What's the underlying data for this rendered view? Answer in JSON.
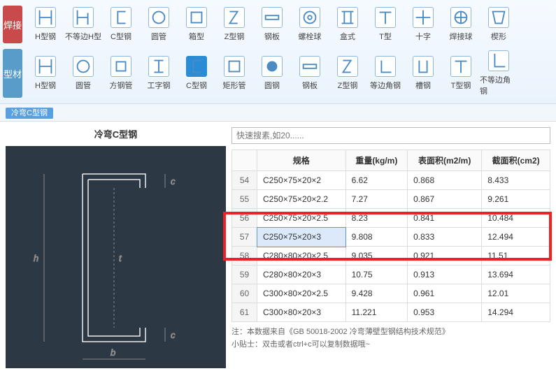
{
  "ribbon": {
    "row1": {
      "tab": "焊接",
      "items": [
        {
          "label": "H型钢",
          "icon": "H"
        },
        {
          "label": "不等边H型",
          "icon": "H2"
        },
        {
          "label": "C型钢",
          "icon": "C"
        },
        {
          "label": "圆管",
          "icon": "circle"
        },
        {
          "label": "箱型",
          "icon": "rect"
        },
        {
          "label": "Z型钢",
          "icon": "Z"
        },
        {
          "label": "钢板",
          "icon": "plate"
        },
        {
          "label": "螺栓球",
          "icon": "bolt"
        },
        {
          "label": "盒式",
          "icon": "box"
        },
        {
          "label": "T型",
          "icon": "T"
        },
        {
          "label": "十字",
          "icon": "cross"
        },
        {
          "label": "焊接球",
          "icon": "ball"
        },
        {
          "label": "楔形",
          "icon": "wedge"
        }
      ]
    },
    "row2": {
      "tab": "型材",
      "items": [
        {
          "label": "H型钢",
          "icon": "H"
        },
        {
          "label": "圆管",
          "icon": "circle"
        },
        {
          "label": "方钢管",
          "icon": "sq"
        },
        {
          "label": "工字钢",
          "icon": "I"
        },
        {
          "label": "C型钢",
          "icon": "C",
          "active": true
        },
        {
          "label": "矩形管",
          "icon": "rect"
        },
        {
          "label": "圆钢",
          "icon": "solid"
        },
        {
          "label": "钢板",
          "icon": "plate"
        },
        {
          "label": "Z型钢",
          "icon": "Z"
        },
        {
          "label": "等边角钢",
          "icon": "L"
        },
        {
          "label": "槽钢",
          "icon": "U"
        },
        {
          "label": "T型钢",
          "icon": "T"
        },
        {
          "label": "不等边角钢",
          "icon": "L2"
        }
      ]
    }
  },
  "breadcrumb": "冷弯C型钢",
  "left": {
    "title": "冷弯C型钢"
  },
  "search": {
    "placeholder": "快速搜素,如20......"
  },
  "table": {
    "headers": {
      "spec": "规格",
      "weight": "重量(kg/m)",
      "area": "表面积(m2/m)",
      "section": "截面积(cm2)"
    },
    "rows": [
      {
        "n": 54,
        "spec": "C250×75×20×2",
        "w": "6.62",
        "a": "0.868",
        "s": "8.433"
      },
      {
        "n": 55,
        "spec": "C250×75×20×2.2",
        "w": "7.27",
        "a": "0.867",
        "s": "9.261"
      },
      {
        "n": 56,
        "spec": "C250×75×20×2.5",
        "w": "8.23",
        "a": "0.841",
        "s": "10.484"
      },
      {
        "n": 57,
        "spec": "C250×75×20×3",
        "w": "9.808",
        "a": "0.833",
        "s": "12.494",
        "selected": true
      },
      {
        "n": 58,
        "spec": "C280×80×20×2.5",
        "w": "9.035",
        "a": "0.921",
        "s": "11.51"
      },
      {
        "n": 59,
        "spec": "C280×80×20×3",
        "w": "10.75",
        "a": "0.913",
        "s": "13.694"
      },
      {
        "n": 60,
        "spec": "C300×80×20×2.5",
        "w": "9.428",
        "a": "0.961",
        "s": "12.01"
      },
      {
        "n": 61,
        "spec": "C300×80×20×3",
        "w": "11.221",
        "a": "0.953",
        "s": "14.294"
      }
    ]
  },
  "footer": {
    "line1": "注：本数据来自《GB 50018-2002 冷弯薄壁型钢结构技术规范》",
    "line2": "小贴士：双击或者ctrl+c可以复制数据哦~"
  },
  "diagram": {
    "h": "h",
    "b": "b",
    "t": "t",
    "c1": "c",
    "c2": "c"
  }
}
